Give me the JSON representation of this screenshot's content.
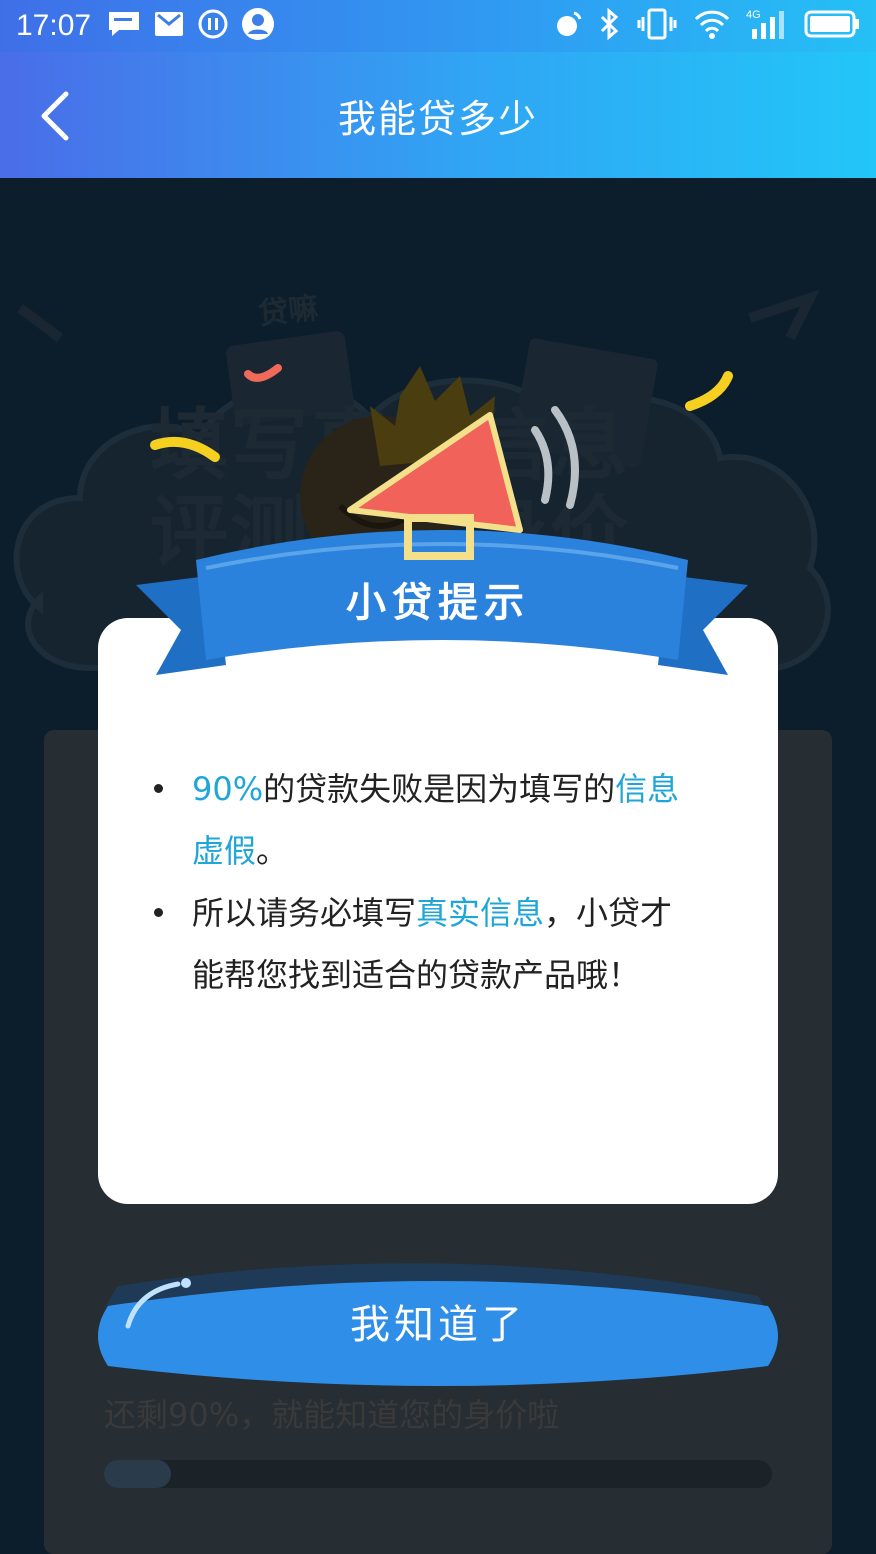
{
  "status_bar": {
    "time": "17:07",
    "left_icons": [
      "message-icon",
      "mail-icon",
      "pause-icon",
      "user-icon"
    ],
    "right_icons": [
      "nfc-icon",
      "bluetooth-icon",
      "vibrate-icon",
      "wifi-icon",
      "signal-4g-icon",
      "battery-icon"
    ],
    "network": "4G"
  },
  "header": {
    "title": "我能贷多少",
    "back_icon": "chevron-left-icon"
  },
  "background": {
    "logo_text": "贷嘛",
    "banner_line1": "填写真实信息",
    "banner_line2": "评测真实身价"
  },
  "dialog": {
    "ribbon_label": "小贷提示",
    "tips": [
      {
        "part1": "90%",
        "part2": "的贷款失败是因为填写的",
        "part3": "信息",
        "part4": "虚假",
        "part5": "。"
      },
      {
        "part1": "所以请务必填写",
        "part2": "真实信息",
        "part3": "，小贷才",
        "part4": "能帮您找到适合的贷款产品哦！"
      }
    ],
    "confirm_label": "我知道了"
  },
  "progress": {
    "text": "还剩90%，就能知道您的身价啦",
    "completed_fraction": 0.1
  },
  "colors": {
    "header_start": "#4a6de8",
    "header_end": "#22c6f8",
    "highlight": "#1fa6d8",
    "button": "#2f8ee8",
    "ribbon": "#2b82dc",
    "megaphone": "#f0625a"
  }
}
